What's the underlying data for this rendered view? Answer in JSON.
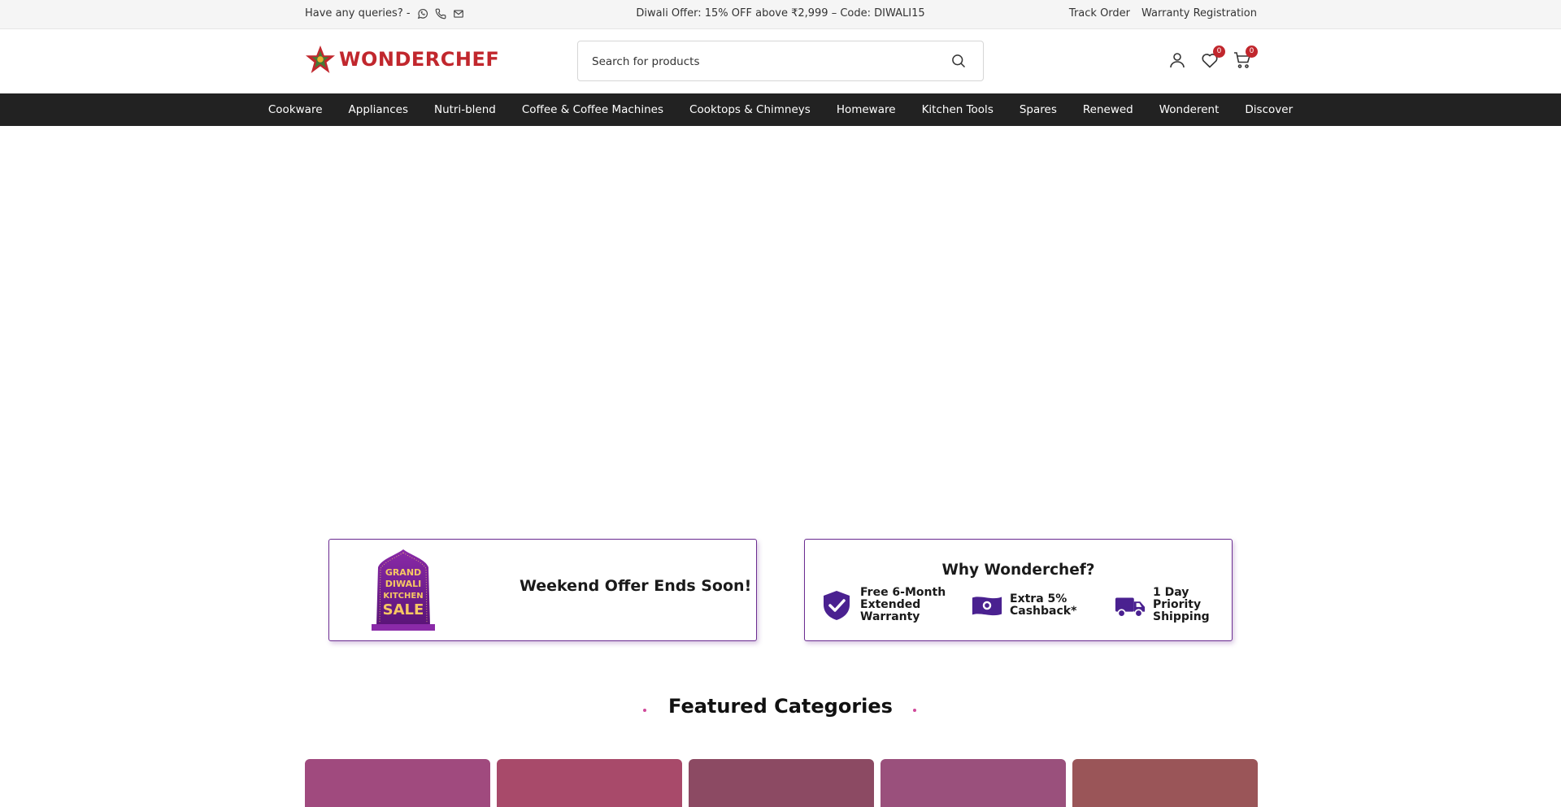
{
  "topbar": {
    "queries_label": "Have any queries? -",
    "icons": [
      "whatsapp-icon",
      "phone-icon",
      "mail-icon"
    ],
    "announcement": "Diwali Offer: 15% OFF above ₹2,999 – Code: DIWALI15",
    "links": [
      "Track Order",
      "Warranty Registration"
    ]
  },
  "header": {
    "brand": "WONDERCHEF",
    "search_placeholder": "Search for products",
    "wishlist_count": "0",
    "cart_count": "0",
    "brand_color": "#c1272d"
  },
  "nav": {
    "items": [
      "Cookware",
      "Appliances",
      "Nutri-blend",
      "Coffee & Coffee Machines",
      "Cooktops & Chimneys",
      "Homeware",
      "Kitchen Tools",
      "Spares",
      "Renewed",
      "Wonderent",
      "Discover"
    ]
  },
  "offer_card": {
    "title": "Weekend Offer Ends Soon!",
    "badge_text": [
      "GRAND",
      "DIWALI",
      "KITCHEN",
      "SALE"
    ]
  },
  "why_card": {
    "title": "Why Wonderchef?",
    "features": [
      {
        "icon": "shield-check-icon",
        "line1": "Free 6-Month",
        "line2": "Extended Warranty"
      },
      {
        "icon": "cash-icon",
        "line1": "Extra 5%",
        "line2": "Cashback*"
      },
      {
        "icon": "truck-icon",
        "line1": "1 Day Priority",
        "line2": "Shipping"
      }
    ],
    "accent_color": "#4a2190"
  },
  "featured": {
    "title": "Featured Categories",
    "tile_colors": [
      "#a04a7e",
      "#a84a6a",
      "#8c4a63",
      "#9a507c",
      "#9a5558"
    ]
  }
}
